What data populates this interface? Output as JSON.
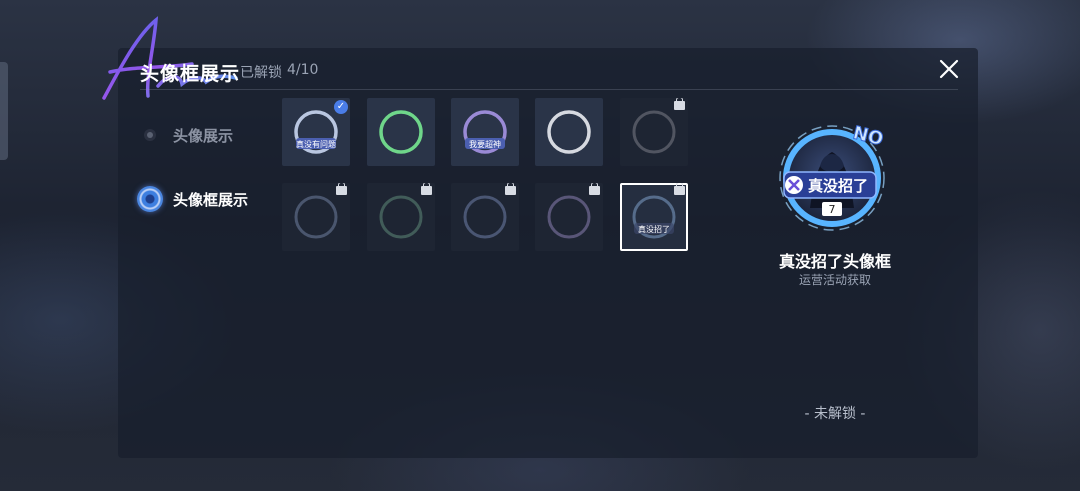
{
  "header": {
    "title": "头像框展示",
    "unlock_label": "已解锁",
    "unlock_count": "4/10",
    "close_icon": "close-icon"
  },
  "sidebar": {
    "items": [
      {
        "label": "头像展示",
        "active": false
      },
      {
        "label": "头像框展示",
        "active": true
      }
    ]
  },
  "frames": [
    {
      "badge": "check",
      "locked": false,
      "equipped": true,
      "ring_color": "#b9c6e0",
      "banner": "真没有问题"
    },
    {
      "badge": "",
      "locked": false,
      "equipped": false,
      "ring_color": "#6fd68a",
      "banner": ""
    },
    {
      "badge": "",
      "locked": false,
      "equipped": false,
      "ring_color": "#9a8ad6",
      "banner": "我要超神"
    },
    {
      "badge": "",
      "locked": false,
      "equipped": false,
      "ring_color": "#d6d9e0",
      "banner": ""
    },
    {
      "badge": "lock",
      "locked": true,
      "equipped": false,
      "ring_color": "#7c7e86",
      "banner": ""
    },
    {
      "badge": "lock",
      "locked": true,
      "equipped": false,
      "ring_color": "#6f7f9e",
      "banner": ""
    },
    {
      "badge": "lock",
      "locked": true,
      "equipped": false,
      "ring_color": "#5f8a78",
      "banner": ""
    },
    {
      "badge": "lock",
      "locked": true,
      "equipped": false,
      "ring_color": "#6f7fa8",
      "banner": ""
    },
    {
      "badge": "lock",
      "locked": true,
      "equipped": false,
      "ring_color": "#8a7fb0",
      "banner": ""
    },
    {
      "badge": "lock",
      "locked": true,
      "equipped": false,
      "selected": true,
      "ring_color": "#7fa0c8",
      "banner": "真没招了"
    }
  ],
  "preview": {
    "name": "真没招了头像框",
    "source": "运营活动获取",
    "banner_text": "真没招了",
    "level": "7",
    "tag": "NO",
    "status": "- 未解锁 -",
    "accent_color": "#4aa8ff"
  }
}
